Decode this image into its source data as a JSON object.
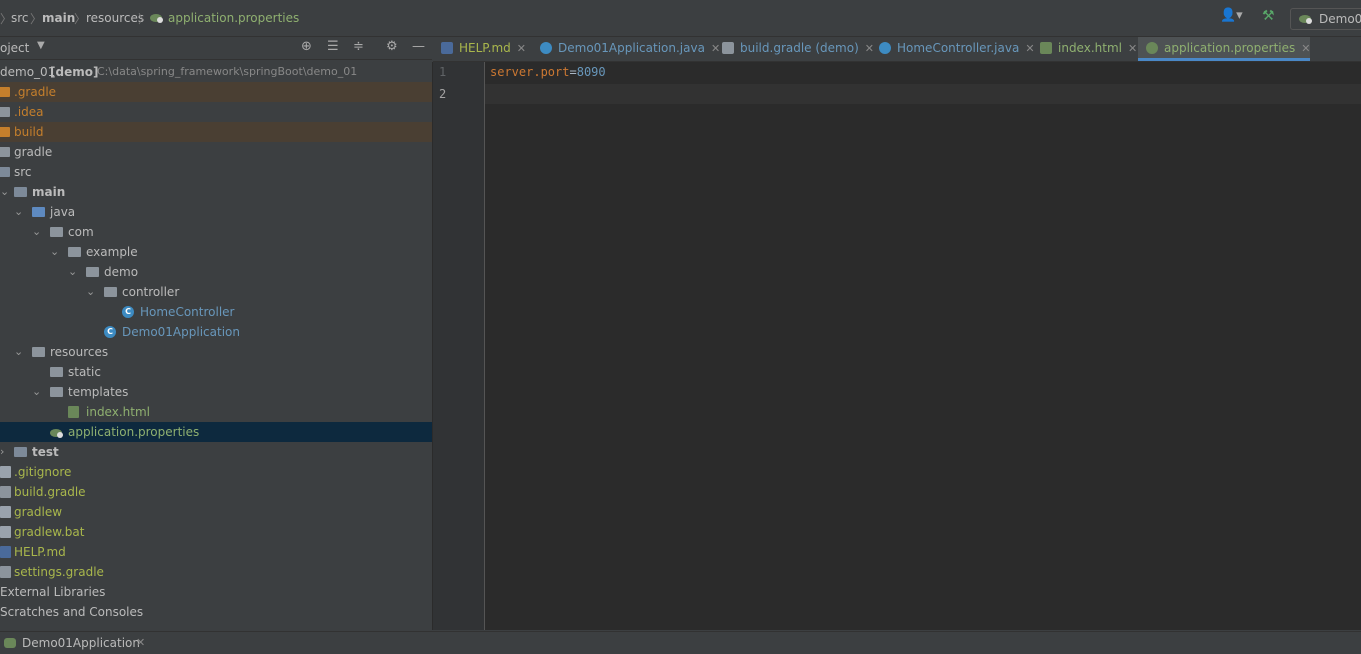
{
  "breadcrumb": {
    "items": [
      "src",
      "main",
      "resources",
      "application.properties"
    ]
  },
  "toolbar": {
    "user_icon": "user-icon",
    "build_icon": "hammer-icon",
    "run_config_label": "Demo0"
  },
  "project_panel": {
    "title": "oject",
    "tool_icons": [
      "locate-icon",
      "expand-all-icon",
      "collapse-all-icon",
      "gear-icon",
      "minimize-icon"
    ]
  },
  "tree": {
    "root_name": "demo_01",
    "root_module": "[demo]",
    "root_path": "C:\\data\\spring_framework\\springBoot\\demo_01",
    "items": [
      {
        "label": ".gradle"
      },
      {
        "label": ".idea"
      },
      {
        "label": "build"
      },
      {
        "label": "gradle"
      },
      {
        "label": "src"
      },
      {
        "label": "main"
      },
      {
        "label": "java"
      },
      {
        "label": "com"
      },
      {
        "label": "example"
      },
      {
        "label": "demo"
      },
      {
        "label": "controller"
      },
      {
        "label": "HomeController"
      },
      {
        "label": "Demo01Application"
      },
      {
        "label": "resources"
      },
      {
        "label": "static"
      },
      {
        "label": "templates"
      },
      {
        "label": "index.html"
      },
      {
        "label": "application.properties"
      },
      {
        "label": "test"
      },
      {
        "label": ".gitignore"
      },
      {
        "label": "build.gradle"
      },
      {
        "label": "gradlew"
      },
      {
        "label": "gradlew.bat"
      },
      {
        "label": "HELP.md"
      },
      {
        "label": "settings.gradle"
      },
      {
        "label": "External Libraries"
      },
      {
        "label": "Scratches and Consoles"
      }
    ]
  },
  "tabs": [
    {
      "label": "HELP.md"
    },
    {
      "label": "Demo01Application.java"
    },
    {
      "label": "build.gradle (demo)"
    },
    {
      "label": "HomeController.java"
    },
    {
      "label": "index.html"
    },
    {
      "label": "application.properties"
    }
  ],
  "editor": {
    "line_numbers": [
      "1",
      "2"
    ],
    "line1_key": "server.port",
    "line1_eq": "=",
    "line1_value": "8090"
  },
  "bottom": {
    "run_tab_label": "Demo01Application"
  },
  "colors": {
    "accent": "#4a88c7",
    "selection": "#0d293e",
    "excluded_folder": "#c57f2c"
  }
}
